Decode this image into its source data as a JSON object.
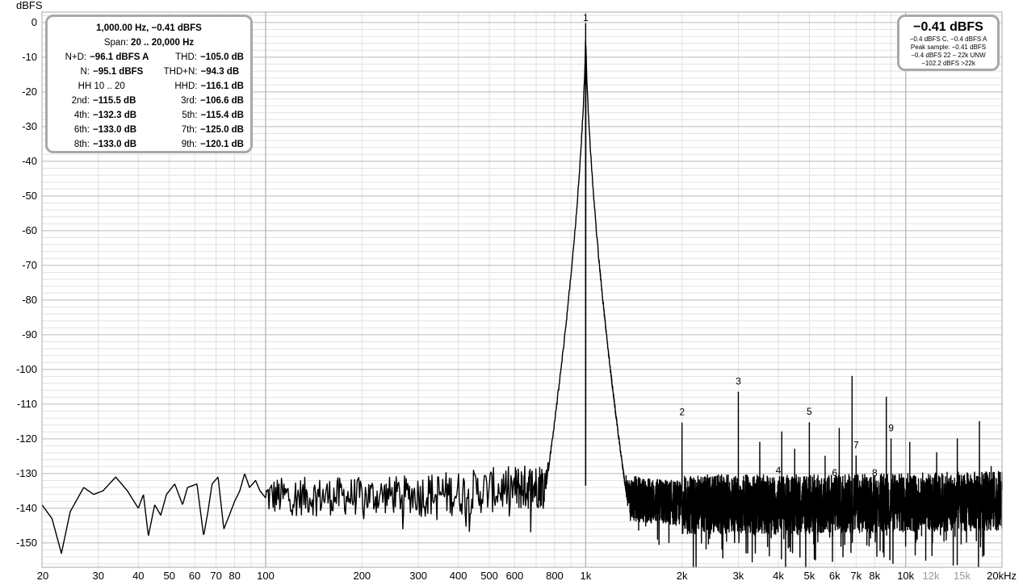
{
  "chart_data": {
    "type": "line",
    "title": "",
    "ylabel": "dBFS",
    "xlabel": "",
    "x_scale": "log",
    "xlim": [
      20,
      20000
    ],
    "ylim": [
      -157,
      3
    ],
    "grid": true,
    "y_ticks": [
      0,
      -10,
      -20,
      -30,
      -40,
      -50,
      -60,
      -70,
      -80,
      -90,
      -100,
      -110,
      -120,
      -130,
      -140,
      -150
    ],
    "x_ticks": [
      {
        "f": 20,
        "label": "20"
      },
      {
        "f": 30,
        "label": "30"
      },
      {
        "f": 40,
        "label": "40"
      },
      {
        "f": 50,
        "label": "50"
      },
      {
        "f": 60,
        "label": "60"
      },
      {
        "f": 70,
        "label": "70"
      },
      {
        "f": 80,
        "label": "80"
      },
      {
        "f": 100,
        "label": "100"
      },
      {
        "f": 200,
        "label": "200"
      },
      {
        "f": 300,
        "label": "300"
      },
      {
        "f": 400,
        "label": "400"
      },
      {
        "f": 500,
        "label": "500"
      },
      {
        "f": 600,
        "label": "600"
      },
      {
        "f": 800,
        "label": "800"
      },
      {
        "f": 1000,
        "label": "1k"
      },
      {
        "f": 2000,
        "label": "2k"
      },
      {
        "f": 3000,
        "label": "3k"
      },
      {
        "f": 4000,
        "label": "4k"
      },
      {
        "f": 5000,
        "label": "5k"
      },
      {
        "f": 6000,
        "label": "6k"
      },
      {
        "f": 7000,
        "label": "7k"
      },
      {
        "f": 8000,
        "label": "8k"
      },
      {
        "f": 10000,
        "label": "10k"
      },
      {
        "f": 12000,
        "label": "12k",
        "dim": true
      },
      {
        "f": 15000,
        "label": "15k",
        "dim": true
      },
      {
        "f": 20000,
        "label": "20kHz"
      }
    ],
    "fundamental": {
      "f": 1000,
      "db": -0.41
    },
    "harmonics": [
      {
        "label": "1",
        "f": 1000,
        "db": -0.41
      },
      {
        "label": "2",
        "f": 2000,
        "db": -115.5
      },
      {
        "label": "3",
        "f": 3000,
        "db": -106.6
      },
      {
        "label": "4",
        "f": 4000,
        "db": -132.3
      },
      {
        "label": "5",
        "f": 5000,
        "db": -115.4
      },
      {
        "label": "6",
        "f": 6000,
        "db": -133.0
      },
      {
        "label": "7",
        "f": 7000,
        "db": -125.0
      },
      {
        "label": "8",
        "f": 8000,
        "db": -133.0
      },
      {
        "label": "9",
        "f": 9000,
        "db": -120.1
      }
    ],
    "spurs": [
      {
        "f": 3500,
        "db": -121
      },
      {
        "f": 4100,
        "db": -118
      },
      {
        "f": 4500,
        "db": -123
      },
      {
        "f": 5600,
        "db": -125
      },
      {
        "f": 6200,
        "db": -117
      },
      {
        "f": 6800,
        "db": -102
      },
      {
        "f": 8700,
        "db": -108
      },
      {
        "f": 10300,
        "db": -121
      },
      {
        "f": 12500,
        "db": -124
      },
      {
        "f": 14500,
        "db": -120
      },
      {
        "f": 17000,
        "db": -115
      },
      {
        "f": 18500,
        "db": -128
      }
    ],
    "low_freq_curve": [
      [
        20,
        -139
      ],
      [
        21.5,
        -143
      ],
      [
        23,
        -153
      ],
      [
        24.5,
        -141
      ],
      [
        27,
        -134
      ],
      [
        29,
        -136
      ],
      [
        31,
        -135
      ],
      [
        34,
        -131
      ],
      [
        37,
        -135
      ],
      [
        40,
        -140
      ],
      [
        41.5,
        -136
      ],
      [
        43,
        -148
      ],
      [
        45,
        -139
      ],
      [
        47,
        -142
      ],
      [
        49,
        -136
      ],
      [
        52,
        -133
      ],
      [
        55,
        -139
      ],
      [
        57,
        -134
      ],
      [
        61,
        -133
      ],
      [
        64,
        -148
      ],
      [
        66,
        -141
      ],
      [
        68,
        -133
      ],
      [
        71,
        -131
      ],
      [
        74,
        -146
      ],
      [
        77,
        -142
      ],
      [
        80,
        -138
      ],
      [
        83,
        -135
      ],
      [
        86,
        -130
      ],
      [
        89,
        -134
      ],
      [
        93,
        -132
      ],
      [
        96,
        -135
      ],
      [
        100,
        -137
      ]
    ],
    "noise_floor": [
      [
        100,
        -136
      ],
      [
        200,
        -136
      ],
      [
        400,
        -135
      ],
      [
        700,
        -133
      ],
      [
        850,
        -131
      ],
      [
        1200,
        -136
      ],
      [
        2000,
        -138
      ],
      [
        5000,
        -138
      ],
      [
        20000,
        -137
      ]
    ]
  },
  "stats": {
    "header": "1,000.00 Hz, −0.41 dBFS",
    "span_label": "Span:",
    "span_value": "20 .. 20,000 Hz",
    "hh_label": "HH 10 .. 20",
    "rows": [
      {
        "l1": "N+D:",
        "v1": "−96.1 dBFS A",
        "l2": "THD:",
        "v2": "−105.0 dB"
      },
      {
        "l1": "N:",
        "v1": "−95.1 dBFS",
        "l2": "THD+N:",
        "v2": "−94.3 dB"
      },
      {
        "l1": "",
        "v1": "",
        "l2": "HHD:",
        "v2": "−116.1 dB"
      },
      {
        "l1": "2nd:",
        "v1": "−115.5 dB",
        "l2": "3rd:",
        "v2": "−106.6 dB"
      },
      {
        "l1": "4th:",
        "v1": "−132.3 dB",
        "l2": "5th:",
        "v2": "−115.4 dB"
      },
      {
        "l1": "6th:",
        "v1": "−133.0 dB",
        "l2": "7th:",
        "v2": "−125.0 dB"
      },
      {
        "l1": "8th:",
        "v1": "−133.0 dB",
        "l2": "9th:",
        "v2": "−120.1 dB"
      }
    ]
  },
  "level": {
    "main": "−0.41 dBFS",
    "line1": "−0.4 dBFS C, −0.4 dBFS A",
    "line2": "Peak sample: −0.41 dBFS",
    "line3": "−0.4 dBFS 22 – 22k UNW",
    "line4": "−102.2 dBFS >22k"
  },
  "colors": {
    "trace": "#000000",
    "grid_major": "#b9b9b9",
    "grid_minor": "#e1e1e1",
    "frame": "#a8a8a8"
  }
}
